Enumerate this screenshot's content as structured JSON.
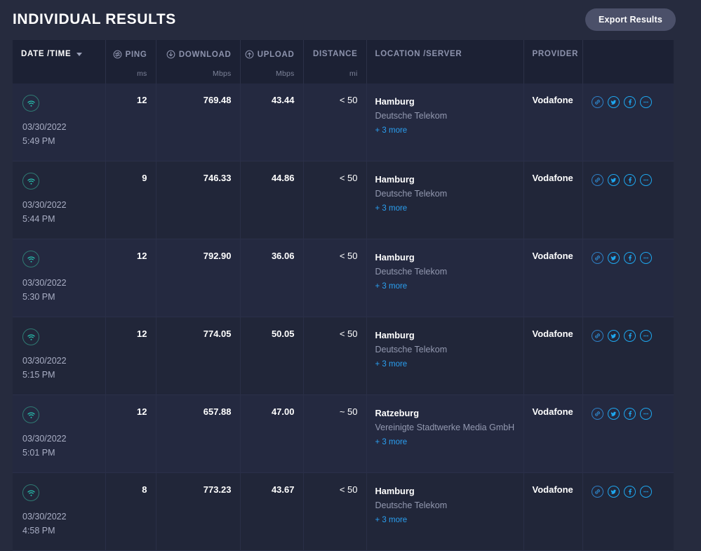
{
  "header": {
    "title": "INDIVIDUAL RESULTS",
    "export_label": "Export Results"
  },
  "theme": {
    "page_bg": "#262b3e",
    "table_header_bg": "#1c2134",
    "row_bg": "#242940",
    "row_alt_bg": "#212639",
    "accent_blue": "#1ea7ef",
    "link_blue": "#2a9ff0",
    "wifi_teal": "#27c2b0",
    "muted_text": "#8d93ad",
    "export_btn_bg": "#4b5069"
  },
  "table": {
    "columns": [
      {
        "key": "datetime",
        "label": "DATE /TIME",
        "unit": "",
        "icon": "none",
        "sorted": true,
        "sort_dir": "desc",
        "align": "left"
      },
      {
        "key": "ping",
        "label": "PING",
        "unit": "ms",
        "icon": "ping-icon",
        "sorted": false,
        "sort_dir": "",
        "align": "right"
      },
      {
        "key": "download",
        "label": "DOWNLOAD",
        "unit": "Mbps",
        "icon": "download-icon",
        "sorted": false,
        "sort_dir": "",
        "align": "right"
      },
      {
        "key": "upload",
        "label": "UPLOAD",
        "unit": "Mbps",
        "icon": "upload-icon",
        "sorted": false,
        "sort_dir": "",
        "align": "right"
      },
      {
        "key": "distance",
        "label": "DISTANCE",
        "unit": "mi",
        "icon": "none",
        "sorted": false,
        "sort_dir": "",
        "align": "right"
      },
      {
        "key": "location",
        "label": "LOCATION /SERVER",
        "unit": "",
        "icon": "none",
        "sorted": false,
        "sort_dir": "",
        "align": "left"
      },
      {
        "key": "provider",
        "label": "PROVIDER",
        "unit": "",
        "icon": "none",
        "sorted": false,
        "sort_dir": "",
        "align": "left"
      },
      {
        "key": "actions",
        "label": "",
        "unit": "",
        "icon": "none",
        "sorted": false,
        "sort_dir": "",
        "align": "left"
      }
    ],
    "rows": [
      {
        "connection_type": "wifi-icon",
        "date": "03/30/2022",
        "time": "5:49 PM",
        "ping": "12",
        "download": "769.48",
        "upload": "43.44",
        "distance": "< 50",
        "city": "Hamburg",
        "server": "Deutsche Telekom",
        "more": "+ 3 more",
        "provider": "Vodafone"
      },
      {
        "connection_type": "wifi-icon",
        "date": "03/30/2022",
        "time": "5:44 PM",
        "ping": "9",
        "download": "746.33",
        "upload": "44.86",
        "distance": "< 50",
        "city": "Hamburg",
        "server": "Deutsche Telekom",
        "more": "+ 3 more",
        "provider": "Vodafone"
      },
      {
        "connection_type": "wifi-icon",
        "date": "03/30/2022",
        "time": "5:30 PM",
        "ping": "12",
        "download": "792.90",
        "upload": "36.06",
        "distance": "< 50",
        "city": "Hamburg",
        "server": "Deutsche Telekom",
        "more": "+ 3 more",
        "provider": "Vodafone"
      },
      {
        "connection_type": "wifi-icon",
        "date": "03/30/2022",
        "time": "5:15 PM",
        "ping": "12",
        "download": "774.05",
        "upload": "50.05",
        "distance": "< 50",
        "city": "Hamburg",
        "server": "Deutsche Telekom",
        "more": "+ 3 more",
        "provider": "Vodafone"
      },
      {
        "connection_type": "wifi-icon",
        "date": "03/30/2022",
        "time": "5:01 PM",
        "ping": "12",
        "download": "657.88",
        "upload": "47.00",
        "distance": "~ 50",
        "city": "Ratzeburg",
        "server": "Vereinigte Stadtwerke Media GmbH",
        "more": "+ 3 more",
        "provider": "Vodafone"
      },
      {
        "connection_type": "wifi-icon",
        "date": "03/30/2022",
        "time": "4:58 PM",
        "ping": "8",
        "download": "773.23",
        "upload": "43.67",
        "distance": "< 50",
        "city": "Hamburg",
        "server": "Deutsche Telekom",
        "more": "+ 3 more",
        "provider": "Vodafone"
      }
    ],
    "row_actions": [
      {
        "name": "copy-link-icon",
        "title": "Copy link"
      },
      {
        "name": "twitter-icon",
        "title": "Share on Twitter"
      },
      {
        "name": "facebook-icon",
        "title": "Share on Facebook"
      },
      {
        "name": "more-icon",
        "title": "More"
      }
    ]
  }
}
